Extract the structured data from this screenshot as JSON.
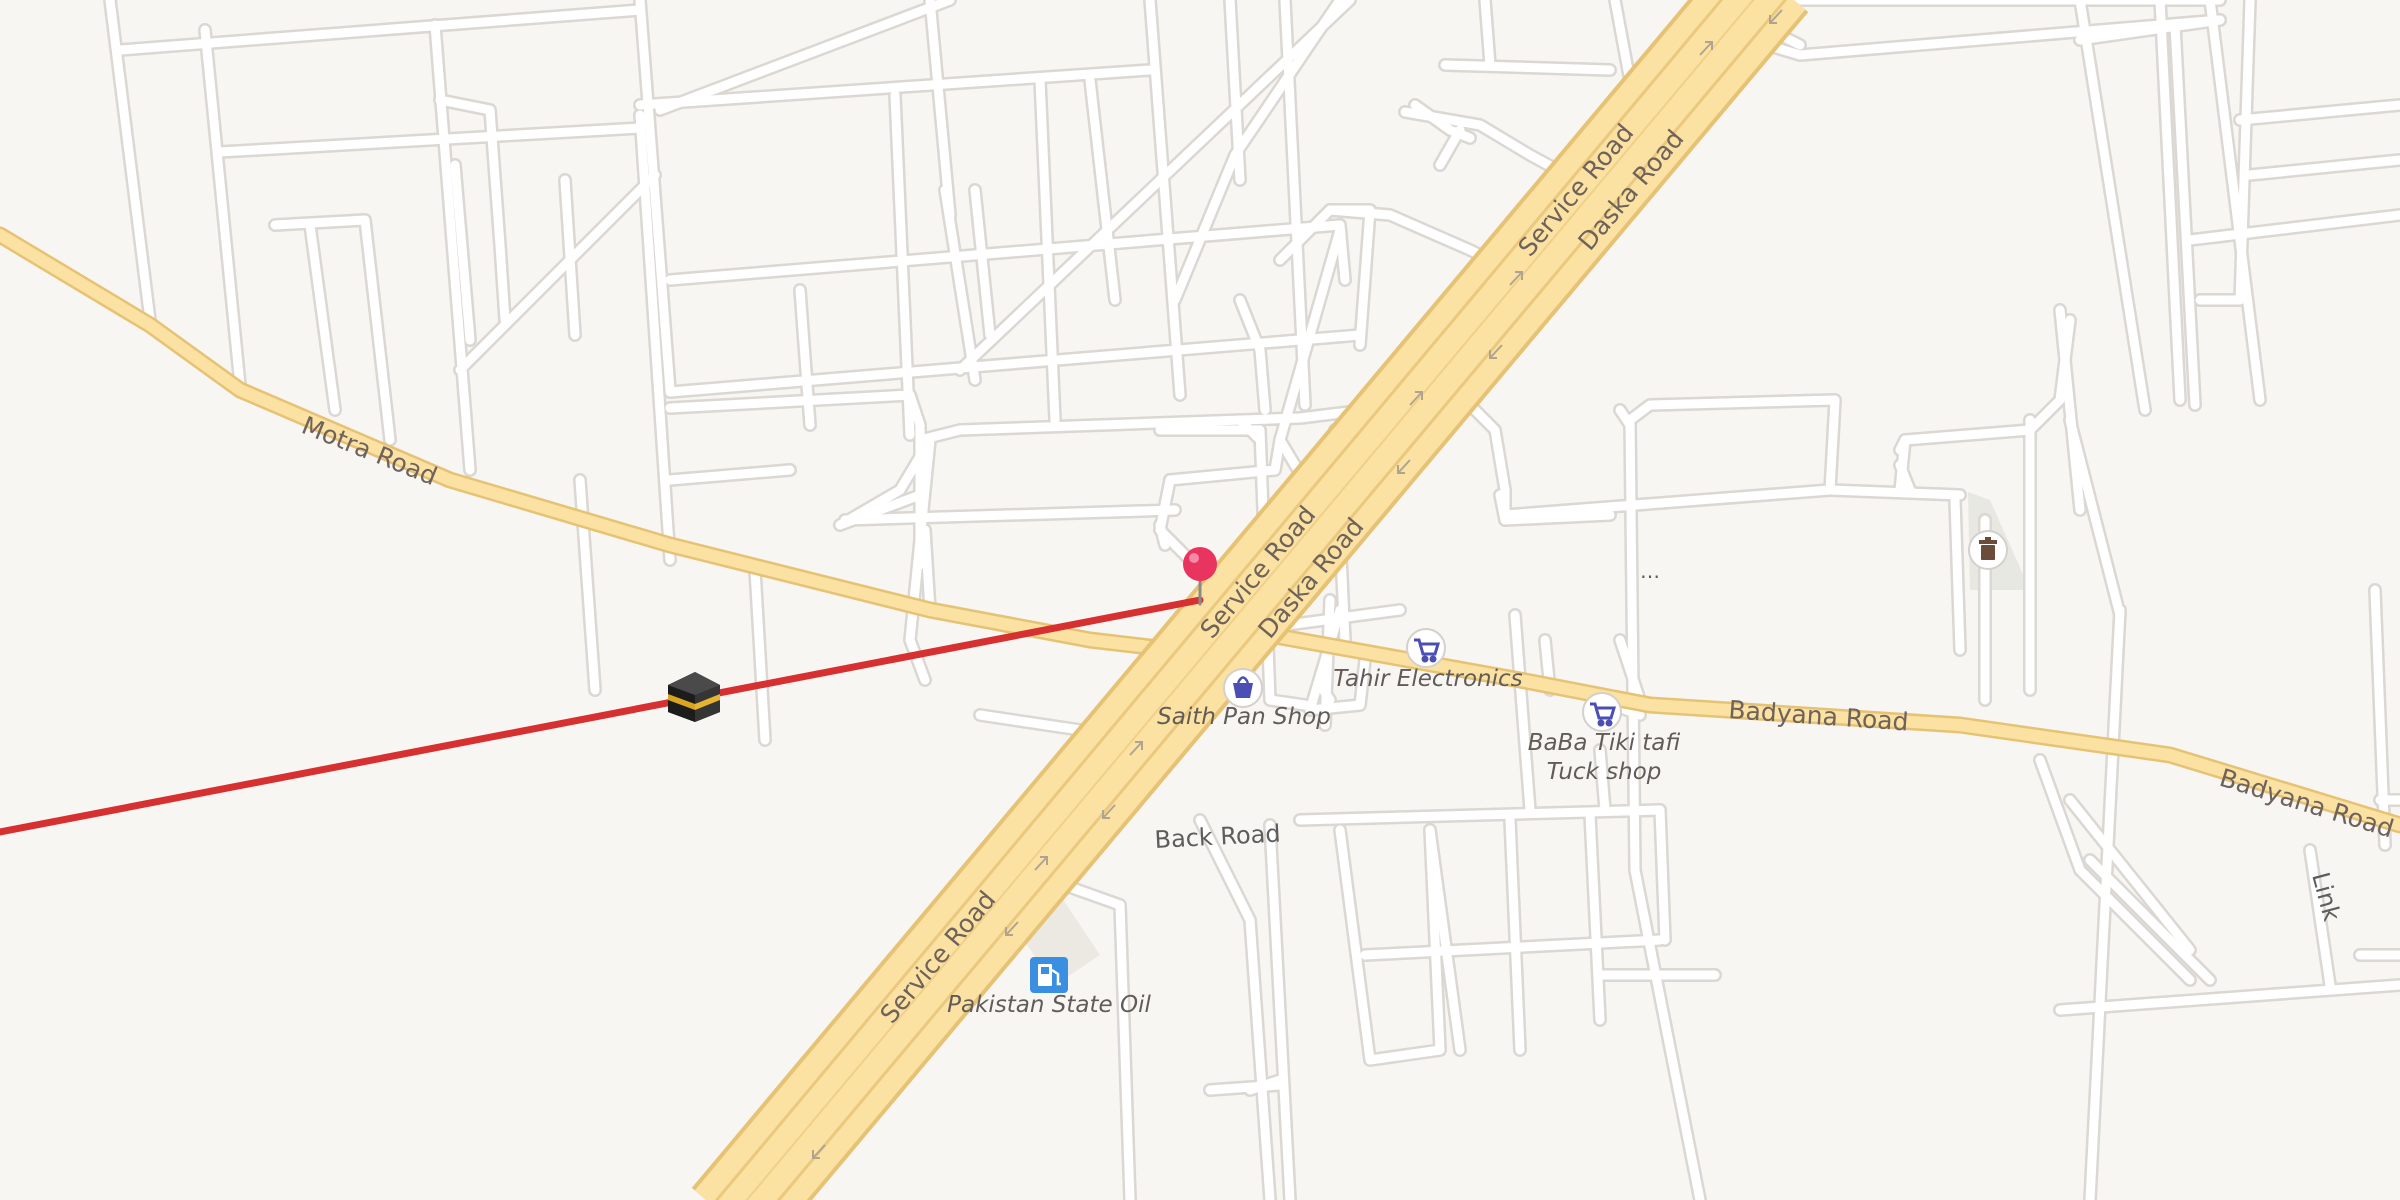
{
  "map": {
    "colors": {
      "background": "#f8f6f3",
      "minor_road": "#ffffff",
      "minor_road_casing": "#dcd8d4",
      "major_road": "#fbe2a2",
      "major_road_casing": "#e6c275",
      "route_line": "#d73030",
      "pin": "#e8345e",
      "poi_icon": "#4b4eb5",
      "fuel_icon": "#3a8fe0",
      "park": "#e5e8e0"
    },
    "road_labels": {
      "motra_road": "Motra Road",
      "service_road_top": "Service Road",
      "daska_road_top": "Daska Road",
      "service_road_mid": "Service Road",
      "daska_road_mid": "Daska Road",
      "service_road_bottom": "Service Road",
      "badyana_road_1": "Badyana Road",
      "badyana_road_2": "Badyana Road",
      "back_road": "Back Road",
      "link": "Link"
    },
    "pois": {
      "tahir": "Tahir Electronics",
      "saith": "Saith Pan Shop",
      "baba_1": "BaBa Tiki tafi",
      "baba_2": "Tuck shop",
      "pso": "Pakistan State Oil"
    },
    "markers": {
      "pin": "dropped-pin",
      "kaaba": "kaaba-icon",
      "qibla": "qibla-direction-line"
    },
    "icons": {
      "shop": "shopping-cart-icon",
      "bag": "shopping-bag-icon",
      "fuel": "fuel-pump-icon",
      "trash": "waste-bin-icon"
    }
  }
}
